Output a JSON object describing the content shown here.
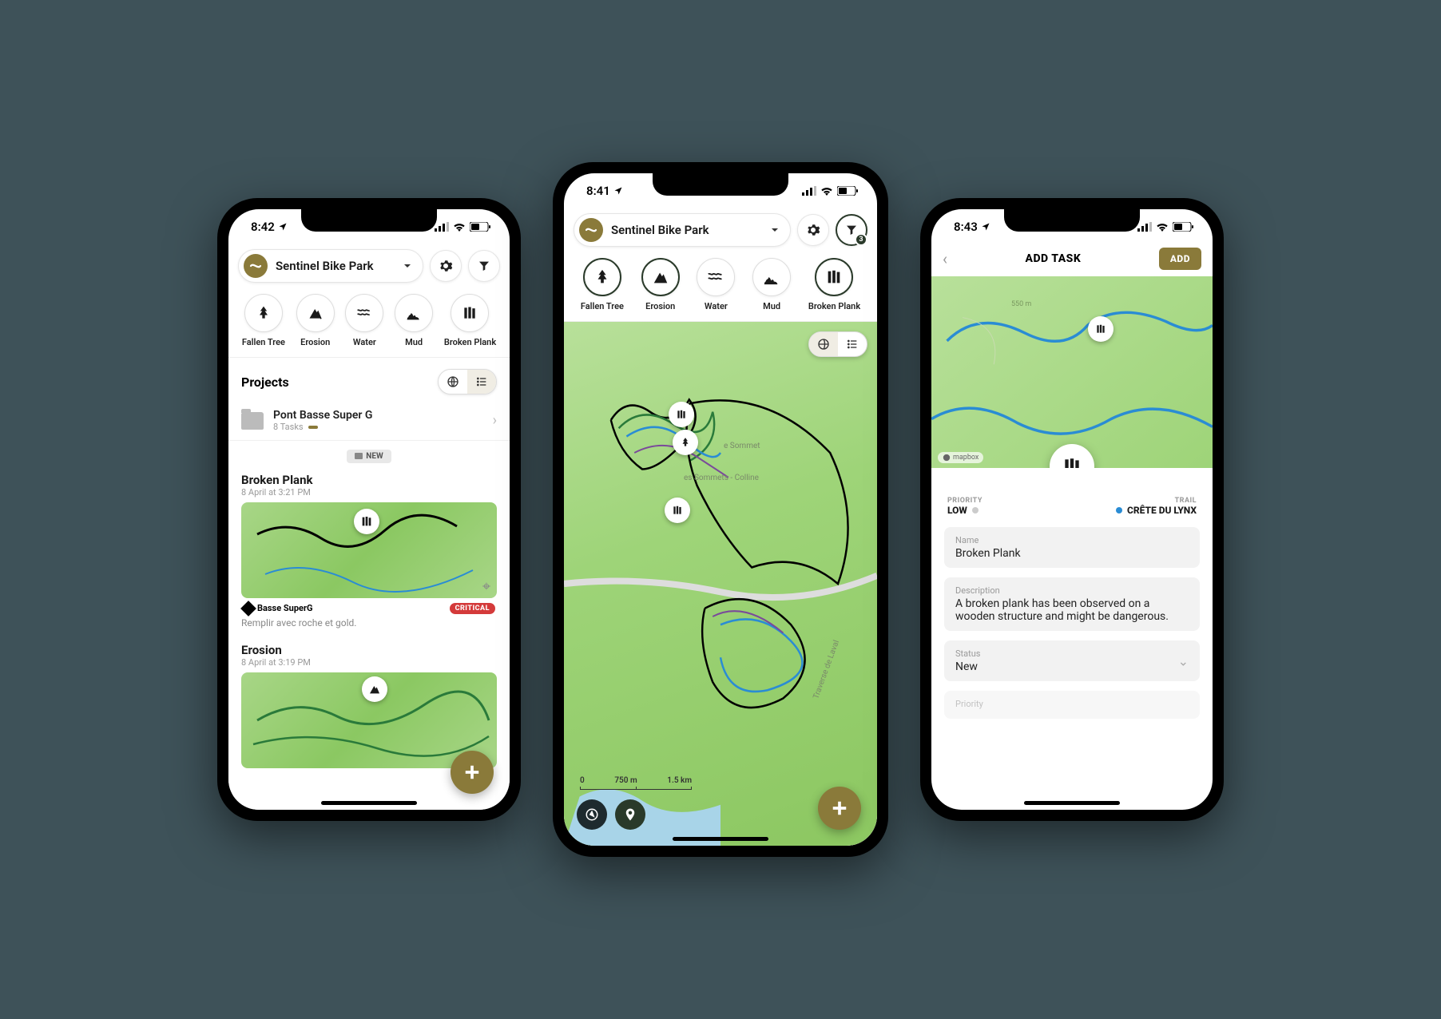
{
  "phone1": {
    "time": "8:42",
    "park": "Sentinel Bike Park",
    "quick": [
      "Fallen Tree",
      "Erosion",
      "Water",
      "Mud",
      "Broken Plank"
    ],
    "projects_title": "Projects",
    "project": {
      "name": "Pont Basse Super G",
      "sub": "8 Tasks"
    },
    "new_badge": "NEW",
    "task1": {
      "title": "Broken Plank",
      "sub": "8 April at 3:21 PM",
      "trail": "Basse SuperG",
      "critical": "CRITICAL",
      "note": "Remplir avec roche et gold."
    },
    "task2": {
      "title": "Erosion",
      "sub": "8 April at 3:19 PM"
    }
  },
  "phone2": {
    "time": "8:41",
    "park": "Sentinel Bike Park",
    "filter_count": "3",
    "quick": [
      "Fallen Tree",
      "Erosion",
      "Water",
      "Mud",
      "Broken Plank"
    ],
    "scale": {
      "a": "0",
      "b": "750 m",
      "c": "1.5 km"
    },
    "map_labels": {
      "summit": "e Sommet",
      "hill": "es Sommets - Colline",
      "road": "Traverse de Laval"
    }
  },
  "phone3": {
    "time": "8:43",
    "title": "ADD TASK",
    "add": "ADD",
    "contour": "550 m",
    "mapbox": "mapbox",
    "priority_label": "PRIORITY",
    "priority_value": "LOW",
    "trail_label": "TRAIL",
    "trail_value": "CRÊTE DU LYNX",
    "name_label": "Name",
    "name_value": "Broken Plank",
    "desc_label": "Description",
    "desc_value": "A broken plank has been observed on a wooden structure and might be dangerous.",
    "status_label": "Status",
    "status_value": "New",
    "prio2_label": "Priority"
  }
}
